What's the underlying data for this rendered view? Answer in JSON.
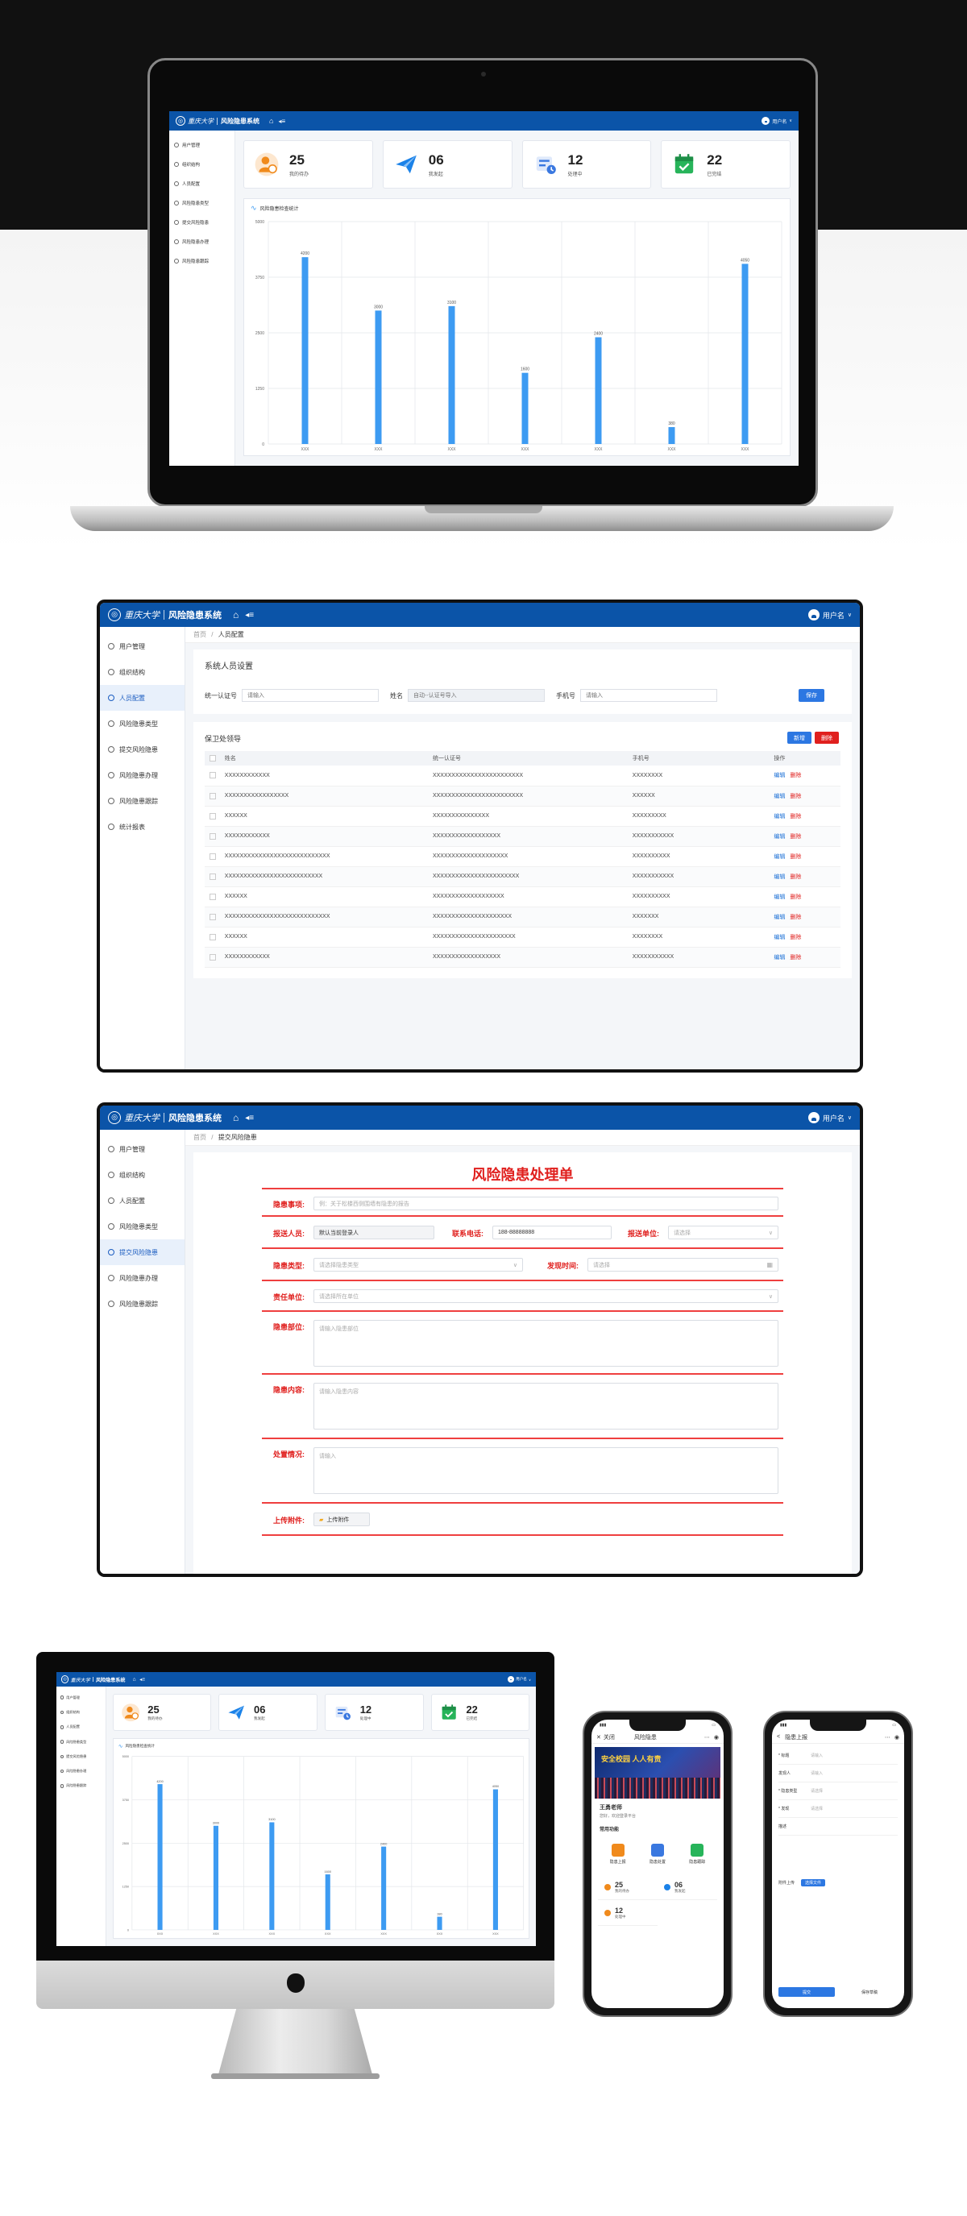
{
  "app": {
    "logo_cal": "重庆大学",
    "system_name": "风险隐患系统",
    "username": "用户名",
    "sidebar": {
      "items": [
        {
          "label": "用户管理"
        },
        {
          "label": "组织结构"
        },
        {
          "label": "人员配置"
        },
        {
          "label": "风险隐患类型"
        },
        {
          "label": "提交风险隐患"
        },
        {
          "label": "风险隐患办理"
        },
        {
          "label": "风险隐患跟踪"
        },
        {
          "label": "统计报表"
        }
      ]
    }
  },
  "dashboard": {
    "stats": [
      {
        "value": "25",
        "label": "我的待办",
        "icon": "user-alert-icon",
        "color": "#f08a1c"
      },
      {
        "value": "06",
        "label": "我发起",
        "icon": "paper-plane-icon",
        "color": "#1b82e8"
      },
      {
        "value": "12",
        "label": "处理中",
        "icon": "form-clock-icon",
        "color": "#3a78e0"
      },
      {
        "value": "22",
        "label": "已完结",
        "icon": "calendar-check-icon",
        "color": "#27b45a"
      }
    ],
    "chart_title": "风险隐患检查统计"
  },
  "chart_data": {
    "type": "bar",
    "title": "风险隐患检查统计",
    "categories": [
      "XXX",
      "XXX",
      "XXX",
      "XXX",
      "XXX",
      "XXX",
      "XXX"
    ],
    "values": [
      4200,
      3000,
      3100,
      1600,
      2400,
      380,
      4050
    ],
    "value_labels": [
      "4200",
      "3000",
      "3100",
      "1600",
      "2400",
      "380",
      "4050"
    ],
    "y_ticks": [
      0,
      1250,
      2500,
      3750,
      5000
    ],
    "y_tick_labels": [
      "0",
      "1250",
      "2500",
      "3750",
      "5000"
    ],
    "ylim": [
      0,
      5000
    ],
    "color": "#3d9bf2",
    "grid": true
  },
  "personnel": {
    "breadcrumb_home": "首页",
    "breadcrumb_sep": "/",
    "breadcrumb_current": "人员配置",
    "section_title": "系统人员设置",
    "filters": [
      {
        "label": "统一认证号",
        "placeholder": "请输入"
      },
      {
        "label": "姓名",
        "placeholder": "自动--认证号导入"
      },
      {
        "label": "手机号",
        "placeholder": "请输入"
      }
    ],
    "save_label": "保存",
    "list_title": "保卫处领导",
    "add_label": "新增",
    "delete_label": "删除",
    "columns": [
      "姓名",
      "统一认证号",
      "手机号",
      "操作"
    ],
    "rows": [
      [
        "XXXXXXXXXXXX",
        "XXXXXXXXXXXXXXXXXXXXXXXX",
        "XXXXXXXX"
      ],
      [
        "XXXXXXXXXXXXXXXXX",
        "XXXXXXXXXXXXXXXXXXXXXXXX",
        "XXXXXX"
      ],
      [
        "XXXXXX",
        "XXXXXXXXXXXXXXX",
        "XXXXXXXXX"
      ],
      [
        "XXXXXXXXXXXX",
        "XXXXXXXXXXXXXXXXXX",
        "XXXXXXXXXXX"
      ],
      [
        "XXXXXXXXXXXXXXXXXXXXXXXXXXXX",
        "XXXXXXXXXXXXXXXXXXXX",
        "XXXXXXXXXX"
      ],
      [
        "XXXXXXXXXXXXXXXXXXXXXXXXXX",
        "XXXXXXXXXXXXXXXXXXXXXXX",
        "XXXXXXXXXXX"
      ],
      [
        "XXXXXX",
        "XXXXXXXXXXXXXXXXXXX",
        "XXXXXXXXXX"
      ],
      [
        "XXXXXXXXXXXXXXXXXXXXXXXXXXXX",
        "XXXXXXXXXXXXXXXXXXXXX",
        "XXXXXXX"
      ],
      [
        "XXXXXX",
        "XXXXXXXXXXXXXXXXXXXXXX",
        "XXXXXXXX"
      ],
      [
        "XXXXXXXXXXXX",
        "XXXXXXXXXXXXXXXXXX",
        "XXXXXXXXXXX"
      ]
    ],
    "edit_link": "编辑",
    "delete_link": "删除"
  },
  "hazard_form": {
    "breadcrumb_home": "首页",
    "breadcrumb_sep": "/",
    "breadcrumb_current": "提交风险隐患",
    "form_title": "风险隐患处理单",
    "fields": {
      "subject_label": "隐患事项:",
      "subject_placeholder": "例：关于松楼西侧围墙有隐患的报告",
      "reporter_label": "报送人员:",
      "reporter_value": "默认当前登录人",
      "phone_label": "联系电话:",
      "phone_value": "188-88888888",
      "unit_label": "报送单位:",
      "unit_placeholder": "请选择",
      "type_label": "隐患类型:",
      "type_placeholder": "请选择隐患类型",
      "time_label": "发现时间:",
      "time_placeholder": "请选择",
      "responsible_label": "责任单位:",
      "responsible_placeholder": "请选择所在单位",
      "location_label": "隐患部位:",
      "location_placeholder": "请输入隐患部位",
      "content_label": "隐患内容:",
      "content_placeholder": "请输入隐患内容",
      "handling_label": "处置情况:",
      "handling_placeholder": "请输入",
      "attachment_label": "上传附件:",
      "upload_button": "上传附件"
    }
  },
  "mobile_home": {
    "close": "关闭",
    "title": "风险隐患",
    "banner_text": "安全校园 人人有责",
    "welcome_title": "王勇老师",
    "welcome_sub": "您好，欢迎登录平台",
    "section": "常用功能",
    "apps": [
      {
        "label": "隐患上报",
        "color": "#f08a1c"
      },
      {
        "label": "隐患处置",
        "color": "#3a78e0"
      },
      {
        "label": "隐患跟踪",
        "color": "#27b45a"
      }
    ],
    "stats": [
      {
        "value": "25",
        "label": "我的待办"
      },
      {
        "value": "06",
        "label": "我发起"
      },
      {
        "value": "12",
        "label": "处理中"
      }
    ]
  },
  "mobile_form": {
    "back": "<",
    "title": "隐患上报",
    "fields": [
      {
        "label": "* 标题",
        "placeholder": "请输入"
      },
      {
        "label": "发现人",
        "placeholder": "请输入"
      },
      {
        "label": "* 隐患类型",
        "placeholder": "请选择"
      },
      {
        "label": "* 发现",
        "placeholder": "请选择"
      },
      {
        "label": "描述",
        "placeholder": ""
      }
    ],
    "upload_label": "附件上传",
    "upload_button": "选择文件",
    "submit": "提交",
    "save_draft": "保存草稿"
  }
}
